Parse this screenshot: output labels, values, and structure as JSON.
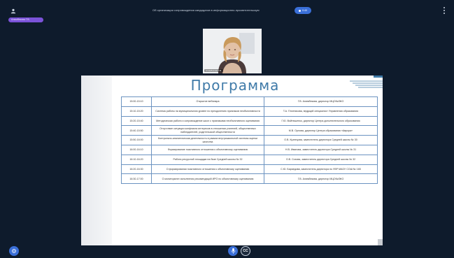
{
  "topbar": {
    "user_chip": "Алимбекова Г.В.",
    "meeting_title": "Об организации сопровождения кандидатов в информационно-просветительскую",
    "record_label": "0:40"
  },
  "video": {
    "speaker_name": "Алимбекова Г.В."
  },
  "slide": {
    "title": "Программа",
    "rows": [
      {
        "time": "15:00-15:10",
        "topic": "Открытие вебинара",
        "speaker": "Г.В. Алимбекова, директор МЦОКиЭКО"
      },
      {
        "time": "15:10-15:20",
        "topic": "Система работы на муниципальном уровне по преодолению признаков необъективности",
        "speaker": "Т.А. Плотникова, ведущий специалист Управления образования"
      },
      {
        "time": "15:20-15:40",
        "topic": "Методическая работа и сопровождение школ с признаками необъективного оценивания",
        "speaker": "Г.Ю. Войтюшенко, директор Центра дополнительного образования"
      },
      {
        "time": "15:40-15:50",
        "topic": "Отсутствие ситуации конфликта интересов в отношении учителей, общественных наблюдателей, родительской общественности",
        "speaker": "М.В. Орлова, директор Центра образования «Аврора»"
      },
      {
        "time": "15:50-16:00",
        "topic": "Контрольно-аналитическая деятельность в рамках внутришкольной системы оценки качества",
        "speaker": "О.В. Кузнецова, заместитель директора Средней школы № 30"
      },
      {
        "time": "16:00-16:10",
        "topic": "Формирование позитивного отношения к объективному оцениванию",
        "speaker": "Н.В. Иванова, заместитель директора Средней школы № 31"
      },
      {
        "time": "16:10-16:20",
        "topic": "Работа ресурсной площадки на базе Средней школы № 32",
        "speaker": "О.В. Сохова, заместитель директора Средней школы № 32"
      },
      {
        "time": "16:20-16:30",
        "topic": "О формировании позитивного отношения к объективному оцениванию",
        "speaker": "С.Ю. Бараедова, заместитель директора по УВР МАОУ СОШ № 165"
      },
      {
        "time": "16:30-17:00",
        "topic": "О мониторинге исполнения рекомендаций ИРО по объективному оцениванию",
        "speaker": "Г.В. Алимбекова, директор МЦОКиЭКО"
      }
    ]
  },
  "bottombar": {
    "cc_label": "CC"
  },
  "colors": {
    "background": "#0e1b2c",
    "accent": "#3a6fd8",
    "chip": "#7b53d9",
    "slide_title": "#3f7aa8"
  }
}
